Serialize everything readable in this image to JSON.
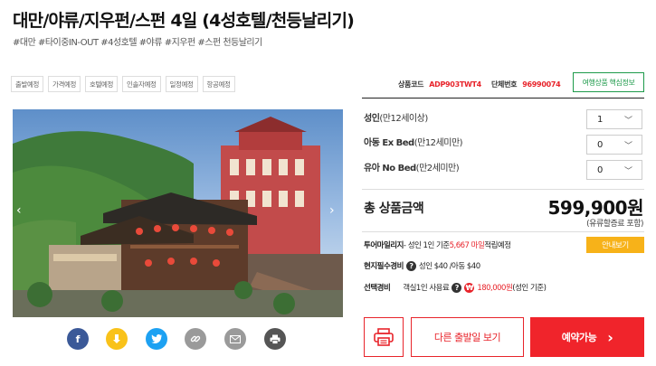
{
  "product": {
    "title": "대만/야류/지우펀/스펀 4일 (4성호텔/천등날리기)",
    "hashtags": "#대만 #타이중IN-OUT #4성호텔 #야류 #지우펀 #스펀 천등날리기"
  },
  "tabs": [
    "출발예정",
    "가격예정",
    "호텔예정",
    "인솔자예정",
    "일정예정",
    "항공예정"
  ],
  "codes": {
    "product_code_label": "상품코드",
    "product_code": "ADP903TWT4",
    "group_code_label": "단체번호",
    "group_code": "96990074"
  },
  "core_info_button": "여행상품 핵심정보",
  "options": [
    {
      "label_bold": "성인",
      "label_rest": "(만12세이상)",
      "value": "1"
    },
    {
      "label_bold": "아동 Ex Bed",
      "label_rest": "(만12세미만)",
      "value": "0"
    },
    {
      "label_bold": "유아 No Bed",
      "label_rest": "(만2세미만)",
      "value": "0"
    }
  ],
  "total": {
    "label": "총 상품금액",
    "price": "599,900원",
    "note": "(유류할증료 포함)"
  },
  "mileage": {
    "label": "투어마일리지",
    "text_before": " - 성인 1인 기준 ",
    "amount": "5,667 마일",
    "text_after": " 적립예정",
    "button": "안내보기"
  },
  "local_fee": {
    "label": "현지필수경비",
    "text": "성인 $40 /아동 $40"
  },
  "optional_fee": {
    "label": "선택경비",
    "text_before": "객실1인 사용료",
    "amount": "180,000원",
    "text_after": "(성인 기준)"
  },
  "actions": {
    "other_dates": "다른 출발일 보기",
    "book": "예약가능",
    "book_arrow": "›"
  },
  "share_icons": [
    "facebook-icon",
    "kakaostory-icon",
    "twitter-icon",
    "link-icon",
    "mail-icon",
    "print-icon"
  ],
  "colors": {
    "accent_red": "#e8242b",
    "book_red": "#f0242b",
    "green": "#1d9a4a",
    "guide_yellow": "#f7b219",
    "facebook": "#3b5998",
    "kakao": "#f9c21a",
    "twitter": "#1da1f2",
    "gray_icon": "#9a9a9a",
    "dark_icon": "#555555"
  }
}
